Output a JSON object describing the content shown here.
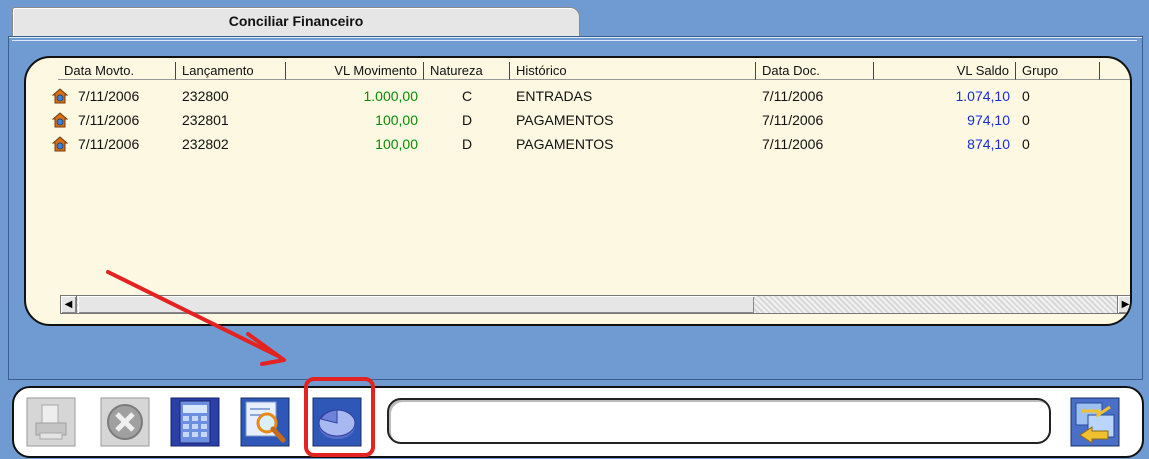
{
  "tab": {
    "title": "Conciliar Financeiro"
  },
  "columns": [
    "Data Movto.",
    "Lançamento",
    "VL Movimento",
    "Natureza",
    "Histórico",
    "Data Doc.",
    "VL Saldo",
    "Grupo"
  ],
  "rows": [
    {
      "data_movto": "7/11/2006",
      "lancamento": "232800",
      "vl_movimento": "1.000,00",
      "natureza": "C",
      "historico": "ENTRADAS",
      "data_doc": "7/11/2006",
      "vl_saldo": "1.074,10",
      "grupo": "0"
    },
    {
      "data_movto": "7/11/2006",
      "lancamento": "232801",
      "vl_movimento": "100,00",
      "natureza": "D",
      "historico": "PAGAMENTOS",
      "data_doc": "7/11/2006",
      "vl_saldo": "974,10",
      "grupo": "0"
    },
    {
      "data_movto": "7/11/2006",
      "lancamento": "232802",
      "vl_movimento": "100,00",
      "natureza": "D",
      "historico": "PAGAMENTOS",
      "data_doc": "7/11/2006",
      "vl_saldo": "874,10",
      "grupo": "0"
    }
  ],
  "colors": {
    "window_bg": "#6f9bd2",
    "grid_bg": "#fcf8e1",
    "credit_green": "#0a8a0a",
    "balance_blue": "#1a2ed6",
    "annotation_red": "#e32222"
  },
  "toolbar": {
    "buttons": [
      "print-icon",
      "cancel-icon",
      "calculator-icon",
      "search-icon",
      "pie-chart-icon",
      "exit-icon"
    ],
    "status_text": ""
  }
}
